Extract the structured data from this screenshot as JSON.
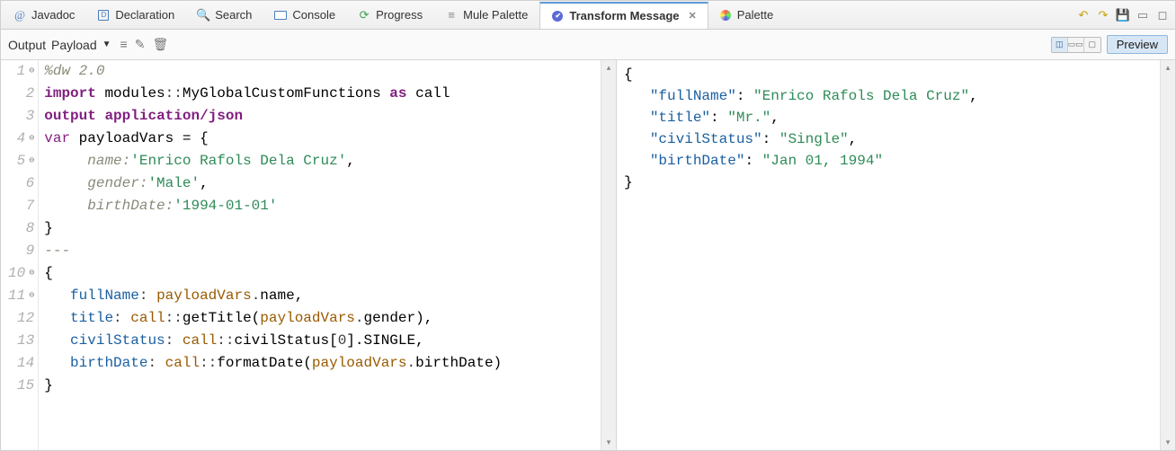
{
  "tabs": [
    {
      "label": "Javadoc",
      "icon": "at"
    },
    {
      "label": "Declaration",
      "icon": "doc-d"
    },
    {
      "label": "Search",
      "icon": "search"
    },
    {
      "label": "Console",
      "icon": "console"
    },
    {
      "label": "Progress",
      "icon": "progress"
    },
    {
      "label": "Mule Palette",
      "icon": "palette-bw"
    },
    {
      "label": "Transform Message",
      "icon": "transform",
      "active": true
    },
    {
      "label": "Palette",
      "icon": "palette-c"
    }
  ],
  "topright_icons": [
    "back-icon",
    "forward-icon",
    "save-icon",
    "minimize-icon",
    "maximize-icon"
  ],
  "subbar": {
    "output_label": "Output",
    "payload_label": "Payload",
    "tool_icons": [
      "dropdown-icon",
      "tree-icon",
      "edit-icon",
      "trash-icon"
    ],
    "preview_label": "Preview"
  },
  "code": {
    "lines": [
      {
        "n": "1",
        "fold": true,
        "tokens": [
          [
            "c-gr",
            "%dw 2.0"
          ]
        ]
      },
      {
        "n": "2",
        "tokens": [
          [
            "c-kw",
            "import"
          ],
          [
            "c-blk",
            " modules"
          ],
          [
            "c-op",
            "::"
          ],
          [
            "c-blk",
            "MyGlobalCustomFunctions "
          ],
          [
            "c-kw",
            "as"
          ],
          [
            "c-blk",
            " call"
          ]
        ]
      },
      {
        "n": "3",
        "tokens": [
          [
            "c-kw",
            "output"
          ],
          [
            "c-blk",
            " "
          ],
          [
            "c-kw",
            "application/json"
          ]
        ]
      },
      {
        "n": "4",
        "fold": true,
        "tokens": [
          [
            "c-kw2",
            "var"
          ],
          [
            "c-blk",
            " payloadVars = {"
          ]
        ]
      },
      {
        "n": "5",
        "bullet": true,
        "tokens": [
          [
            "c-gr",
            "     name:"
          ],
          [
            "c-str",
            "'Enrico Rafols Dela Cruz'"
          ],
          [
            "c-blk",
            ","
          ]
        ]
      },
      {
        "n": "6",
        "tokens": [
          [
            "c-gr",
            "     gender:"
          ],
          [
            "c-str",
            "'Male'"
          ],
          [
            "c-blk",
            ","
          ]
        ]
      },
      {
        "n": "7",
        "tokens": [
          [
            "c-gr",
            "     birthDate:"
          ],
          [
            "c-str",
            "'1994-01-01'"
          ]
        ]
      },
      {
        "n": "8",
        "tokens": [
          [
            "c-blk",
            "}"
          ]
        ]
      },
      {
        "n": "9",
        "tokens": [
          [
            "c-gr",
            "---"
          ]
        ]
      },
      {
        "n": "10",
        "fold": true,
        "tokens": [
          [
            "c-blk",
            "{"
          ]
        ]
      },
      {
        "n": "11",
        "bullet": true,
        "tokens": [
          [
            "c-blue",
            "   fullName"
          ],
          [
            "c-op",
            ": "
          ],
          [
            "c-brn",
            "payloadVars"
          ],
          [
            "c-op",
            "."
          ],
          [
            "c-blk",
            "name,"
          ]
        ]
      },
      {
        "n": "12",
        "tokens": [
          [
            "c-blue",
            "   title"
          ],
          [
            "c-op",
            ": "
          ],
          [
            "c-brn",
            "call"
          ],
          [
            "c-op",
            "::"
          ],
          [
            "c-blk",
            "getTitle("
          ],
          [
            "c-brn",
            "payloadVars"
          ],
          [
            "c-op",
            "."
          ],
          [
            "c-blk",
            "gender),"
          ]
        ]
      },
      {
        "n": "13",
        "tokens": [
          [
            "c-blue",
            "   civilStatus"
          ],
          [
            "c-op",
            ": "
          ],
          [
            "c-brn",
            "call"
          ],
          [
            "c-op",
            "::"
          ],
          [
            "c-blk",
            "civilStatus["
          ],
          [
            "c-num",
            "0"
          ],
          [
            "c-blk",
            "].SINGLE,"
          ]
        ]
      },
      {
        "n": "14",
        "tokens": [
          [
            "c-blue",
            "   birthDate"
          ],
          [
            "c-op",
            ": "
          ],
          [
            "c-brn",
            "call"
          ],
          [
            "c-op",
            "::"
          ],
          [
            "c-blk",
            "formatDate("
          ],
          [
            "c-brn",
            "payloadVars"
          ],
          [
            "c-op",
            "."
          ],
          [
            "c-blk",
            "birthDate)"
          ]
        ]
      },
      {
        "n": "15",
        "tokens": [
          [
            "c-blk",
            "}"
          ]
        ]
      }
    ]
  },
  "output_json": [
    [
      [
        "j-punc",
        "{"
      ]
    ],
    [
      [
        "j-punc",
        "   "
      ],
      [
        "j-key",
        "\"fullName\""
      ],
      [
        "j-punc",
        ": "
      ],
      [
        "j-str",
        "\"Enrico Rafols Dela Cruz\""
      ],
      [
        "j-punc",
        ","
      ]
    ],
    [
      [
        "j-punc",
        "   "
      ],
      [
        "j-key",
        "\"title\""
      ],
      [
        "j-punc",
        ": "
      ],
      [
        "j-str",
        "\"Mr.\""
      ],
      [
        "j-punc",
        ","
      ]
    ],
    [
      [
        "j-punc",
        "   "
      ],
      [
        "j-key",
        "\"civilStatus\""
      ],
      [
        "j-punc",
        ": "
      ],
      [
        "j-str",
        "\"Single\""
      ],
      [
        "j-punc",
        ","
      ]
    ],
    [
      [
        "j-punc",
        "   "
      ],
      [
        "j-key",
        "\"birthDate\""
      ],
      [
        "j-punc",
        ": "
      ],
      [
        "j-str",
        "\"Jan 01, 1994\""
      ]
    ],
    [
      [
        "j-punc",
        "}"
      ]
    ]
  ]
}
